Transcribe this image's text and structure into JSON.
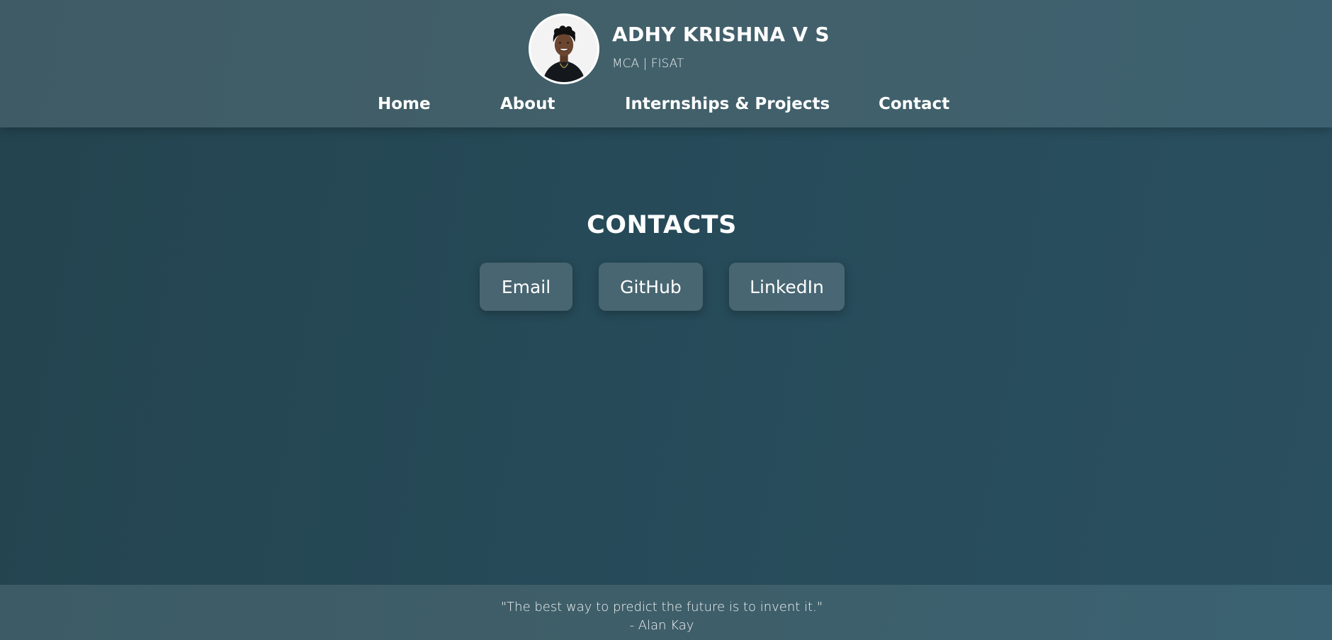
{
  "header": {
    "name": "ADHY KRISHNA V S",
    "subtitle": "MCA | FISAT",
    "avatar_alt": "Profile photo",
    "nav": {
      "home": "Home",
      "about": "About",
      "projects": "Internships & Projects",
      "contact": "Contact"
    }
  },
  "main": {
    "title": "CONTACTS",
    "buttons": {
      "email": "Email",
      "github": "GitHub",
      "linkedin": "LinkedIn"
    }
  },
  "footer": {
    "quote": "\"The best way to predict the future is to invent it.\"",
    "author": "- Alan Kay"
  },
  "colors": {
    "header_bg": "#42606a",
    "body_bg": "#264a58",
    "button_bg": "#5b7079",
    "text": "#ffffff"
  }
}
